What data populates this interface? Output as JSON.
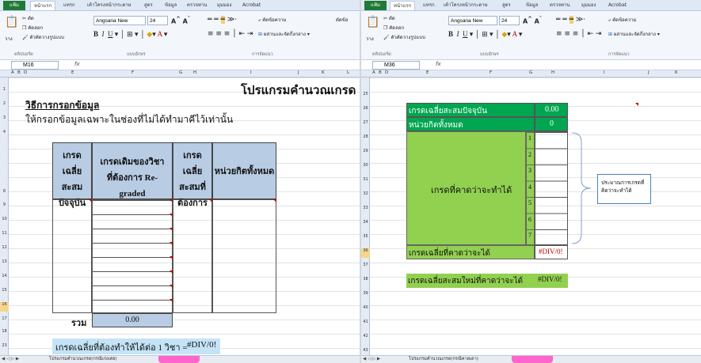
{
  "ribbon": {
    "file_tab": "แฟ้ม",
    "tabs_left": [
      "หน้าแรก",
      "แทรก",
      "เค้าโครงหน้ากระดาษ",
      "สูตร",
      "ข้อมูล",
      "ตรวจทาน",
      "มุมมอง",
      "Acrobat"
    ],
    "tabs_right": [
      "หน้าแรก",
      "แทรก",
      "เค้าโครงหน้ากระดาษ",
      "สูตร",
      "ข้อมูล",
      "ตรวจทาน",
      "มุมมอง",
      "Acrobat"
    ],
    "cut": "ตัด",
    "copy": "คัดลอก",
    "format_painter": "ตัวคัดวางรูปแบบ",
    "paste": "วาง",
    "group_clipboard": "คลิปบอร์ด",
    "group_font": "แบบอักษร",
    "group_alignment": "การจัดแนว",
    "font_name": "Angsana New",
    "font_size": "24",
    "wrap_text": "ตัดข้อความ",
    "merge_center": "ผสานและจัดกึ่งกลาง",
    "merge_center_left": "ผสานและจัดกึ่งกลาง",
    "wrap_left": "ตัดข้อ"
  },
  "left": {
    "name_box": "M16",
    "fx": "fx",
    "col_headers": [
      "A",
      "B",
      "D",
      "E",
      "F",
      "G",
      "H",
      "I",
      "J",
      "K",
      "L"
    ],
    "rows": [
      "1",
      "2",
      "3",
      "4",
      "8",
      "9",
      "10",
      "11",
      "12",
      "13",
      "14",
      "15",
      "16",
      "17",
      "18",
      "23"
    ],
    "title": "โปรแกรมคำนวณเกรด",
    "howto": "วิธีการกรอกข้อมูล",
    "instruction": "ให้กรอกข้อมูลเฉพาะในช่องที่ไม่ได้ทำมาคีไว้เท่านั้น",
    "h_gpax": "เกรดเฉลี่ยสะสมปัจจุบัน",
    "h_regrade": "เกรดเดิมของวิชาที่ต้องการ Re-graded",
    "h_target": "เกรดเฉลี่ยสะสมที่ต้องการ",
    "h_credits": "หน่วยกิตทั้งหมด",
    "sum_label": "รวม",
    "sum_value": "0.00",
    "result_label": "เกรดเฉลี่ยที่ต้องทำให้ได้ต่อ 1 วิชา =",
    "result_value": "#DIV/0!",
    "sheet_tab": "โปรแกรมคำนวณเกรด(กรณีเก่งเคย)"
  },
  "right": {
    "name_box": "M36",
    "fx": "fx",
    "col_headers": [
      "A",
      "B",
      "D",
      "E",
      "F",
      "G",
      "H",
      "I",
      "J",
      "K"
    ],
    "rows": [
      "25",
      "26",
      "27",
      "28",
      "29",
      "30",
      "31",
      "32",
      "33",
      "34",
      "35",
      "36",
      "37",
      "38",
      "39",
      "40",
      "41",
      "42",
      "43"
    ],
    "gpax_label": "เกรดเฉลี่ยสะสมปัจจุบัน",
    "gpax_value": "0.00",
    "credits_label": "หน่วยกิตทั้งหมด",
    "credits_value": "0",
    "expected_label": "เกรดที่คาดว่าจะทำได้",
    "numbers": [
      "1",
      "2",
      "3",
      "4",
      "5",
      "6",
      "7"
    ],
    "expected_avg_label": "เกรดเฉลี่ยที่คาดว่าจะได้",
    "expected_avg_value": "#DIV/0!",
    "new_gpax_label": "เกรดเฉลี่ยสะสมใหม่ที่คาดว่าจะได้",
    "new_gpax_value": "#DIV/0!",
    "note": "ประมาณการเกรดที่คิดว่าจะทำได้",
    "sheet_tab": "โปรแกรมคำนวณเกรด(กรณีคาดเดา)"
  }
}
